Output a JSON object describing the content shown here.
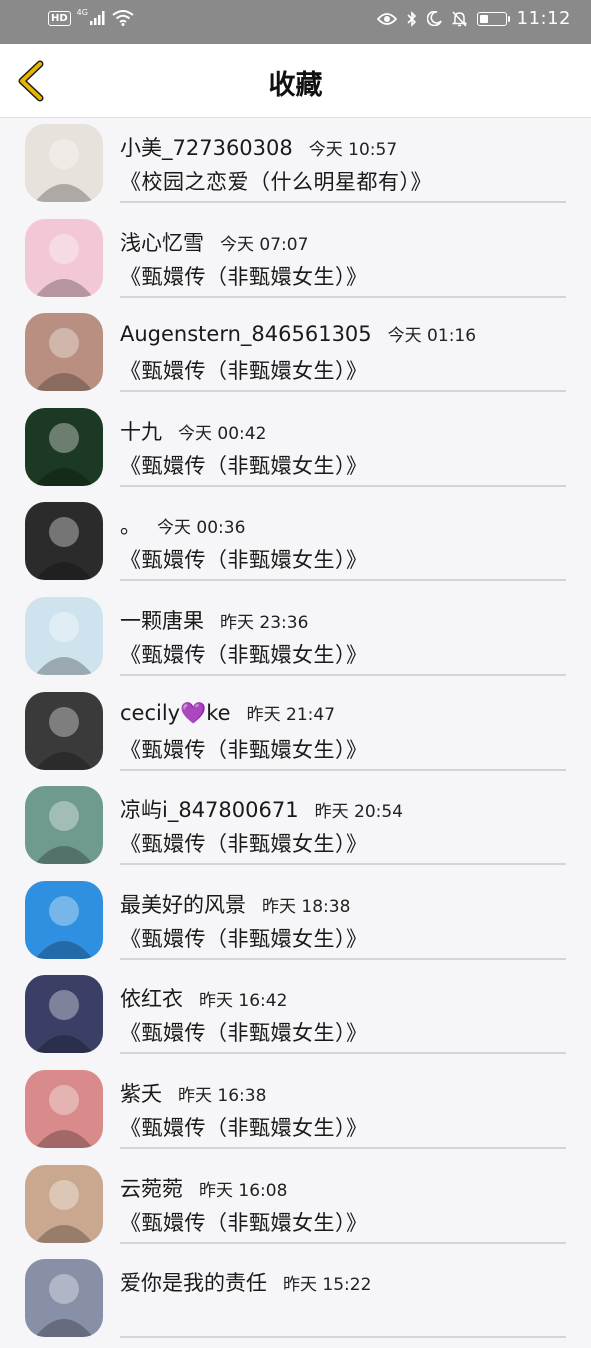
{
  "status_bar": {
    "hd": "HD",
    "network": "4G",
    "time": "11:12",
    "battery_level": 0.35,
    "icons": [
      "hd-icon",
      "signal-icon",
      "wifi-icon",
      "eye-icon",
      "bluetooth-icon",
      "moon-icon",
      "bell-off-icon",
      "battery-icon"
    ]
  },
  "header": {
    "title": "收藏",
    "back_icon": "chevron-left-icon",
    "accent_color": "#e8b400"
  },
  "items": [
    {
      "name": "小美_727360308",
      "time": "今天 10:57",
      "title": "《校园之恋爱（什么明星都有）》",
      "avatar_color": "#e7e2dc"
    },
    {
      "name": "浅心忆雪",
      "time": "今天 07:07",
      "title": "《甄嬛传（非甄嬛女生）》",
      "avatar_color": "#f2c7d6"
    },
    {
      "name": "Augenstern_846561305",
      "time": "今天 01:16",
      "title": "《甄嬛传（非甄嬛女生）》",
      "avatar_color": "#b88f80"
    },
    {
      "name": "十九",
      "time": "今天 00:42",
      "title": "《甄嬛传（非甄嬛女生）》",
      "avatar_color": "#1c3a23"
    },
    {
      "name": "。",
      "time": "今天 00:36",
      "title": "《甄嬛传（非甄嬛女生）》",
      "avatar_color": "#2b2b2b"
    },
    {
      "name": "一颗唐果",
      "time": "昨天 23:36",
      "title": "《甄嬛传（非甄嬛女生）》",
      "avatar_color": "#cfe3ee"
    },
    {
      "name": "cecily",
      "heart": "💜",
      "name_suffix": "ke",
      "time": "昨天 21:47",
      "title": "《甄嬛传（非甄嬛女生）》",
      "avatar_color": "#3a3a3a"
    },
    {
      "name": "凉屿i_847800671",
      "time": "昨天 20:54",
      "title": "《甄嬛传（非甄嬛女生）》",
      "avatar_color": "#6f9a8e"
    },
    {
      "name": "最美好的风景",
      "time": "昨天 18:38",
      "title": "《甄嬛传（非甄嬛女生）》",
      "avatar_color": "#2f8fe0"
    },
    {
      "name": "依红衣",
      "time": "昨天 16:42",
      "title": "《甄嬛传（非甄嬛女生）》",
      "avatar_color": "#3b3f66"
    },
    {
      "name": "紫夭",
      "time": "昨天 16:38",
      "title": "《甄嬛传（非甄嬛女生）》",
      "avatar_color": "#d98a8a"
    },
    {
      "name": "云菀菀",
      "time": "昨天 16:08",
      "title": "《甄嬛传（非甄嬛女生）》",
      "avatar_color": "#c9a88f"
    },
    {
      "name": "爱你是我的责任",
      "time": "昨天 15:22",
      "title": "",
      "avatar_color": "#8890a8"
    }
  ]
}
